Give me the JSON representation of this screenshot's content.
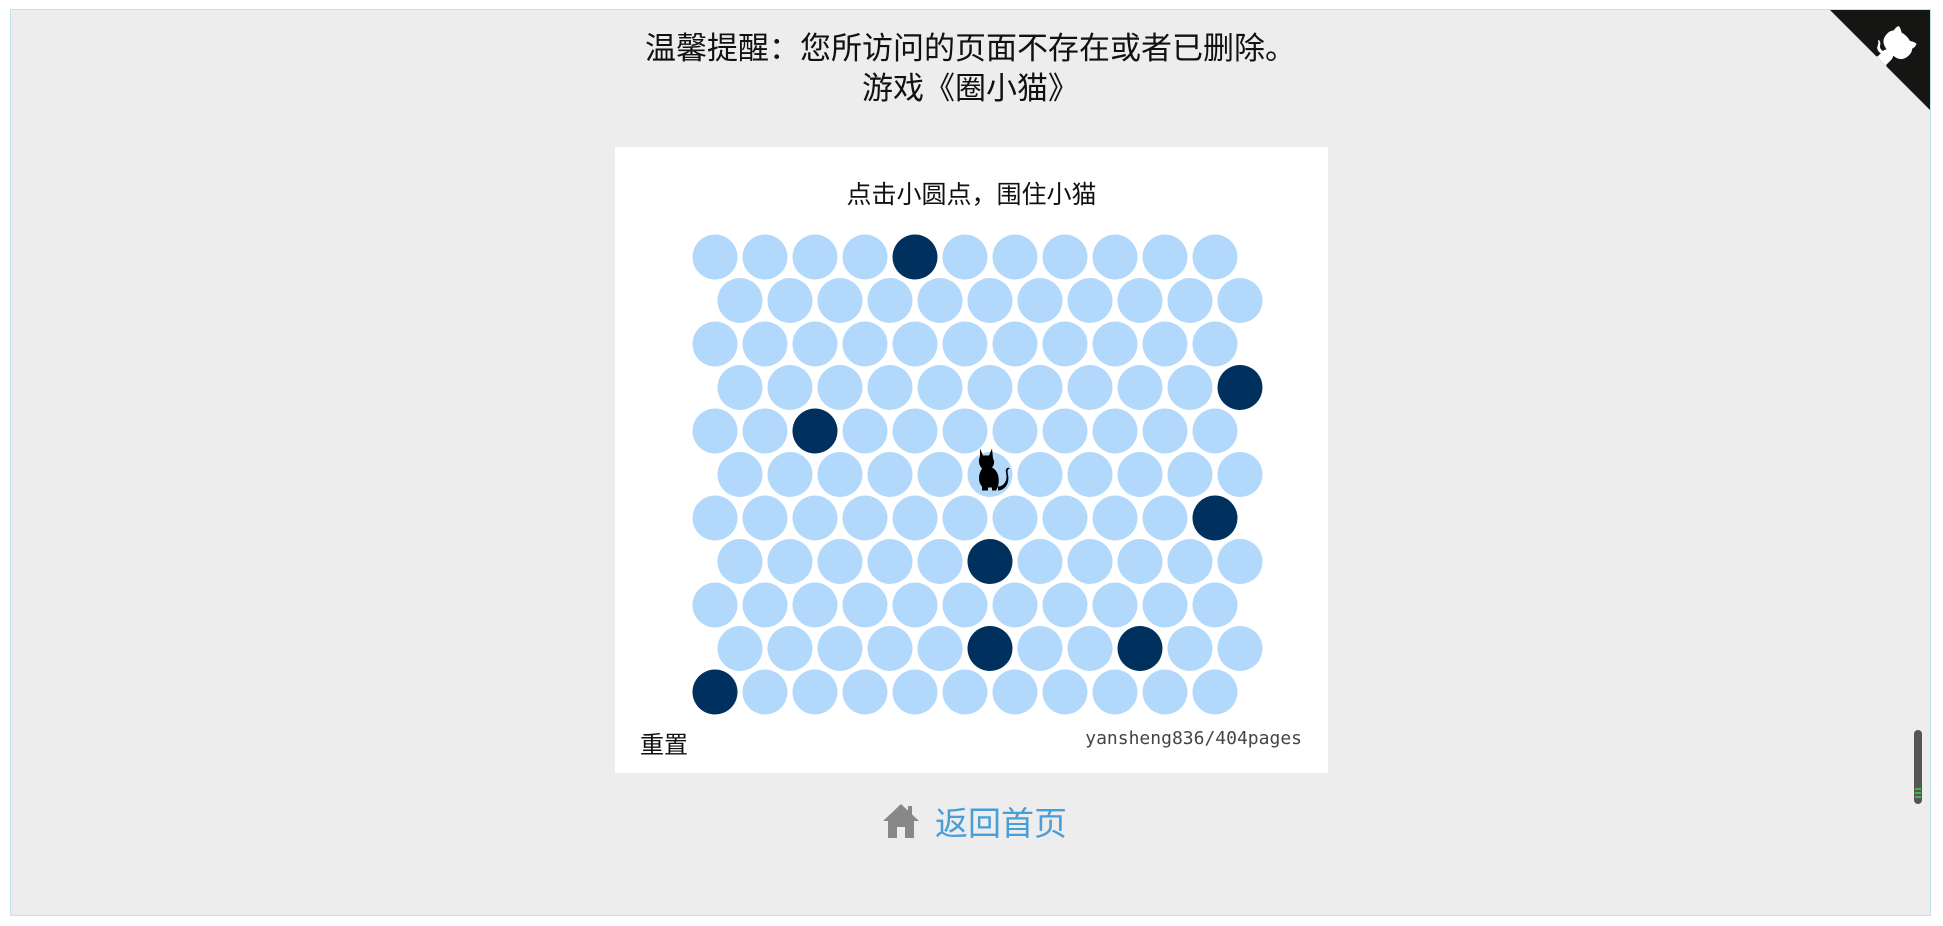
{
  "notice": {
    "line1": "温馨提醒：您所访问的页面不存在或者已删除。",
    "line2": "游戏《圈小猫》"
  },
  "game": {
    "hint": "点击小圆点，围住小猫",
    "reset_label": "重置",
    "repo_label": "yansheng836/404pages",
    "rows": 11,
    "cols": 11,
    "blocked": [
      [
        0,
        4
      ],
      [
        3,
        10
      ],
      [
        4,
        2
      ],
      [
        6,
        10
      ],
      [
        7,
        5
      ],
      [
        9,
        5
      ],
      [
        9,
        8
      ],
      [
        10,
        0
      ]
    ],
    "cat": [
      5,
      5
    ],
    "colors": {
      "empty": "#b2d8fb",
      "blocked": "#00305e",
      "cat": "#000000"
    }
  },
  "home": {
    "label": "返回首页",
    "icon": "home-icon"
  },
  "github_corner": {
    "icon": "github-octocat-icon",
    "colors": {
      "background": "#151513",
      "foreground": "#ffffff"
    }
  }
}
